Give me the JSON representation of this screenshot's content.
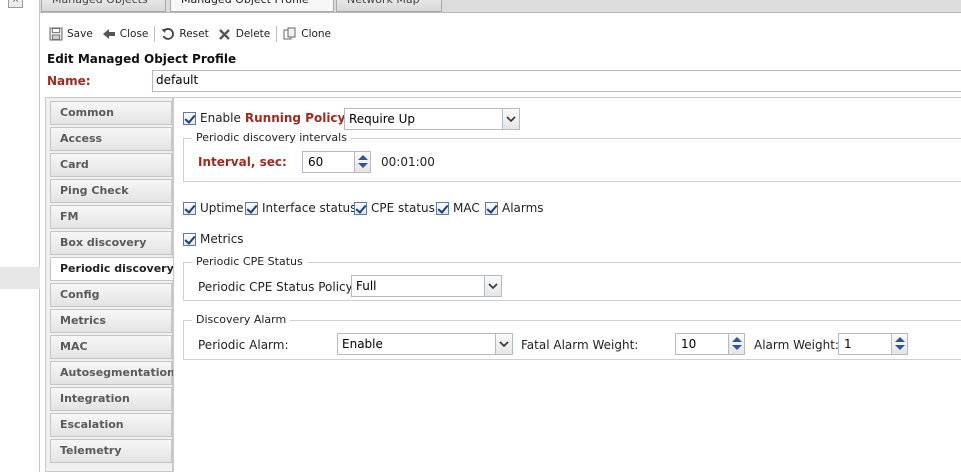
{
  "tabs": [
    {
      "label": "Managed Objects",
      "state": "inactive"
    },
    {
      "label": "Managed Object Profile",
      "state": "active"
    },
    {
      "label": "Network Map",
      "state": "inactive"
    }
  ],
  "close_glyph": "×",
  "toolbar": {
    "save": "Save",
    "close": "Close",
    "reset": "Reset",
    "delete": "Delete",
    "clone": "Clone"
  },
  "form": {
    "title": "Edit Managed Object Profile",
    "name_label": "Name:",
    "name_value": "default"
  },
  "sidebar": {
    "items": [
      {
        "label": "Common"
      },
      {
        "label": "Access"
      },
      {
        "label": "Card"
      },
      {
        "label": "Ping Check"
      },
      {
        "label": "FM"
      },
      {
        "label": "Box discovery"
      },
      {
        "label": "Periodic discovery",
        "active": true
      },
      {
        "label": "Config"
      },
      {
        "label": "Metrics"
      },
      {
        "label": "MAC"
      },
      {
        "label": "Autosegmentation"
      },
      {
        "label": "Integration"
      },
      {
        "label": "Escalation"
      },
      {
        "label": "Telemetry"
      }
    ]
  },
  "periodic": {
    "enable_label": "Enable",
    "running_policy_label": "Running Policy:",
    "running_policy_value": "Require Up",
    "intervals_legend": "Periodic discovery intervals",
    "interval_label": "Interval, sec:",
    "interval_value": "60",
    "interval_human": "00:01:00",
    "checks": {
      "uptime": "Uptime",
      "interface_status": "Interface status",
      "cpe_status": "CPE status",
      "mac": "MAC",
      "alarms": "Alarms",
      "metrics": "Metrics"
    },
    "cpe_legend": "Periodic CPE Status",
    "cpe_policy_label": "Periodic CPE Status Policy:",
    "cpe_policy_value": "Full",
    "alarm_legend": "Discovery Alarm",
    "periodic_alarm_label": "Periodic Alarm:",
    "periodic_alarm_value": "Enable",
    "fatal_weight_label": "Fatal Alarm Weight:",
    "fatal_weight_value": "10",
    "alarm_weight_label": "Alarm Weight:",
    "alarm_weight_value": "1"
  },
  "colors": {
    "required_label": "#9e2a1e",
    "checkbox_check": "#1d3f75"
  }
}
